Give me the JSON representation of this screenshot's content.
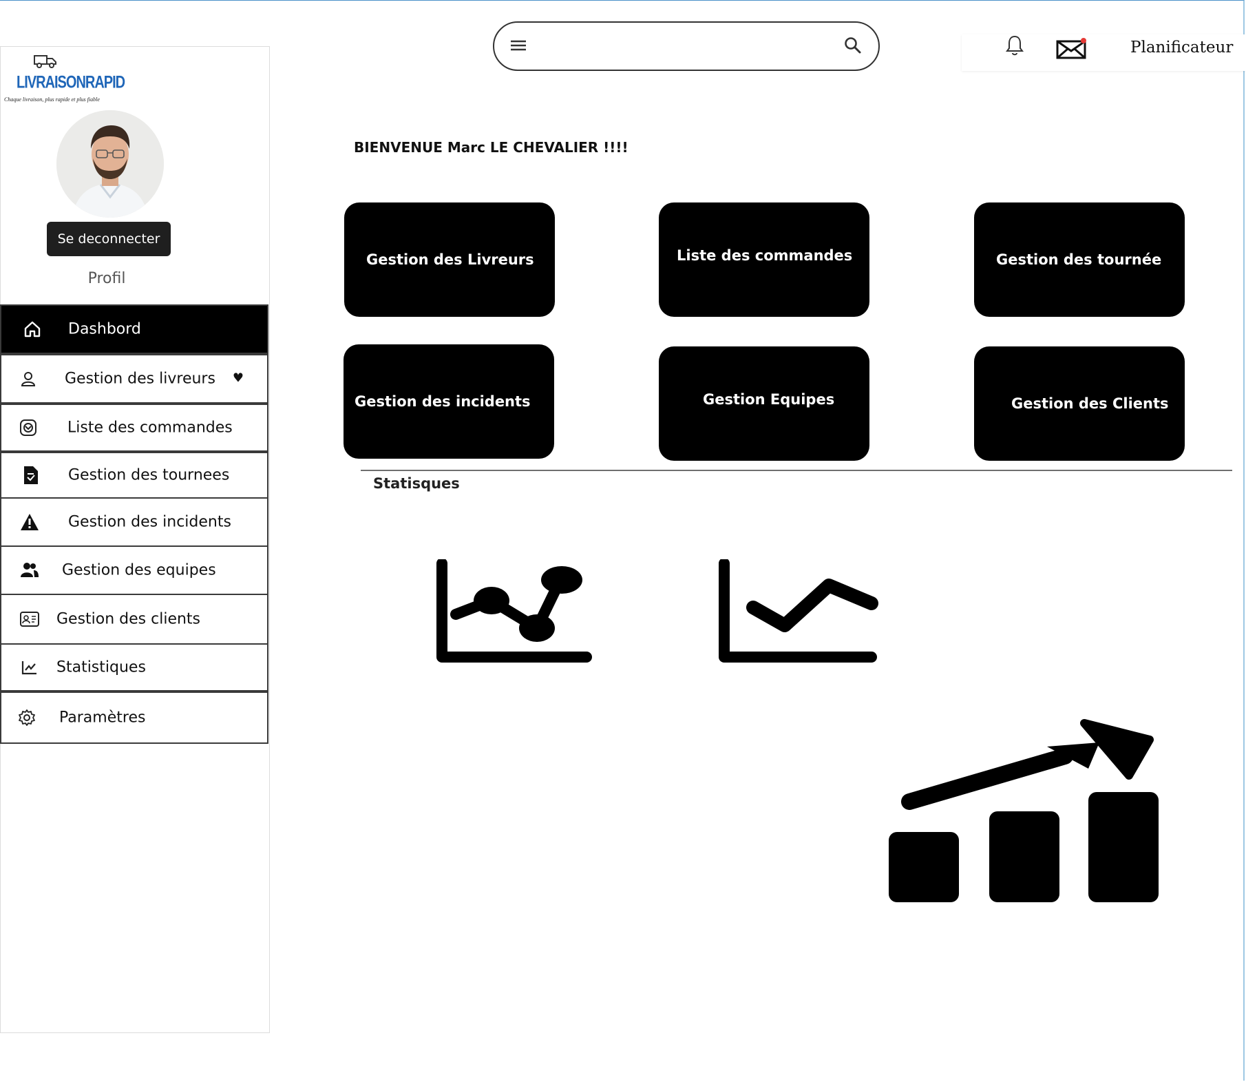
{
  "brand": {
    "logo_text": "LIVRAISONRAPID",
    "tagline": "Chaque livraison, plus rapide et plus fiable"
  },
  "profile": {
    "logout_label": "Se deconnecter",
    "profile_label": "Profil"
  },
  "sidebar": {
    "items": [
      {
        "label": "Dashbord",
        "icon": "home-icon",
        "active": true
      },
      {
        "label": "Gestion des livreurs",
        "icon": "user-icon",
        "caret": "♥"
      },
      {
        "label": "Liste des commandes",
        "icon": "box-icon"
      },
      {
        "label": "Gestion des tournees",
        "icon": "route-document-icon"
      },
      {
        "label": "Gestion des incidents",
        "icon": "warning-icon"
      },
      {
        "label": "Gestion des equipes",
        "icon": "team-icon"
      },
      {
        "label": "Gestion des clients",
        "icon": "contact-card-icon"
      },
      {
        "label": "Statistiques",
        "icon": "line-chart-icon"
      },
      {
        "label": "Paramètres",
        "icon": "gear-icon"
      }
    ]
  },
  "header": {
    "search_placeholder": "",
    "user_role": "Planificateur"
  },
  "main": {
    "welcome": "BIENVENUE  Marc LE CHEVALIER !!!!",
    "cards": [
      {
        "label": "Gestion des Livreurs"
      },
      {
        "label": "Liste des commandes"
      },
      {
        "label": "Gestion des tournée"
      },
      {
        "label": "Gestion des incidents"
      },
      {
        "label": "Gestion Equipes"
      },
      {
        "label": "Gestion des Clients"
      }
    ],
    "stats_title": "Statisques"
  },
  "colors": {
    "accent": "#000000",
    "logo_blue": "#1f66b8",
    "notification_dot": "#e53935"
  }
}
